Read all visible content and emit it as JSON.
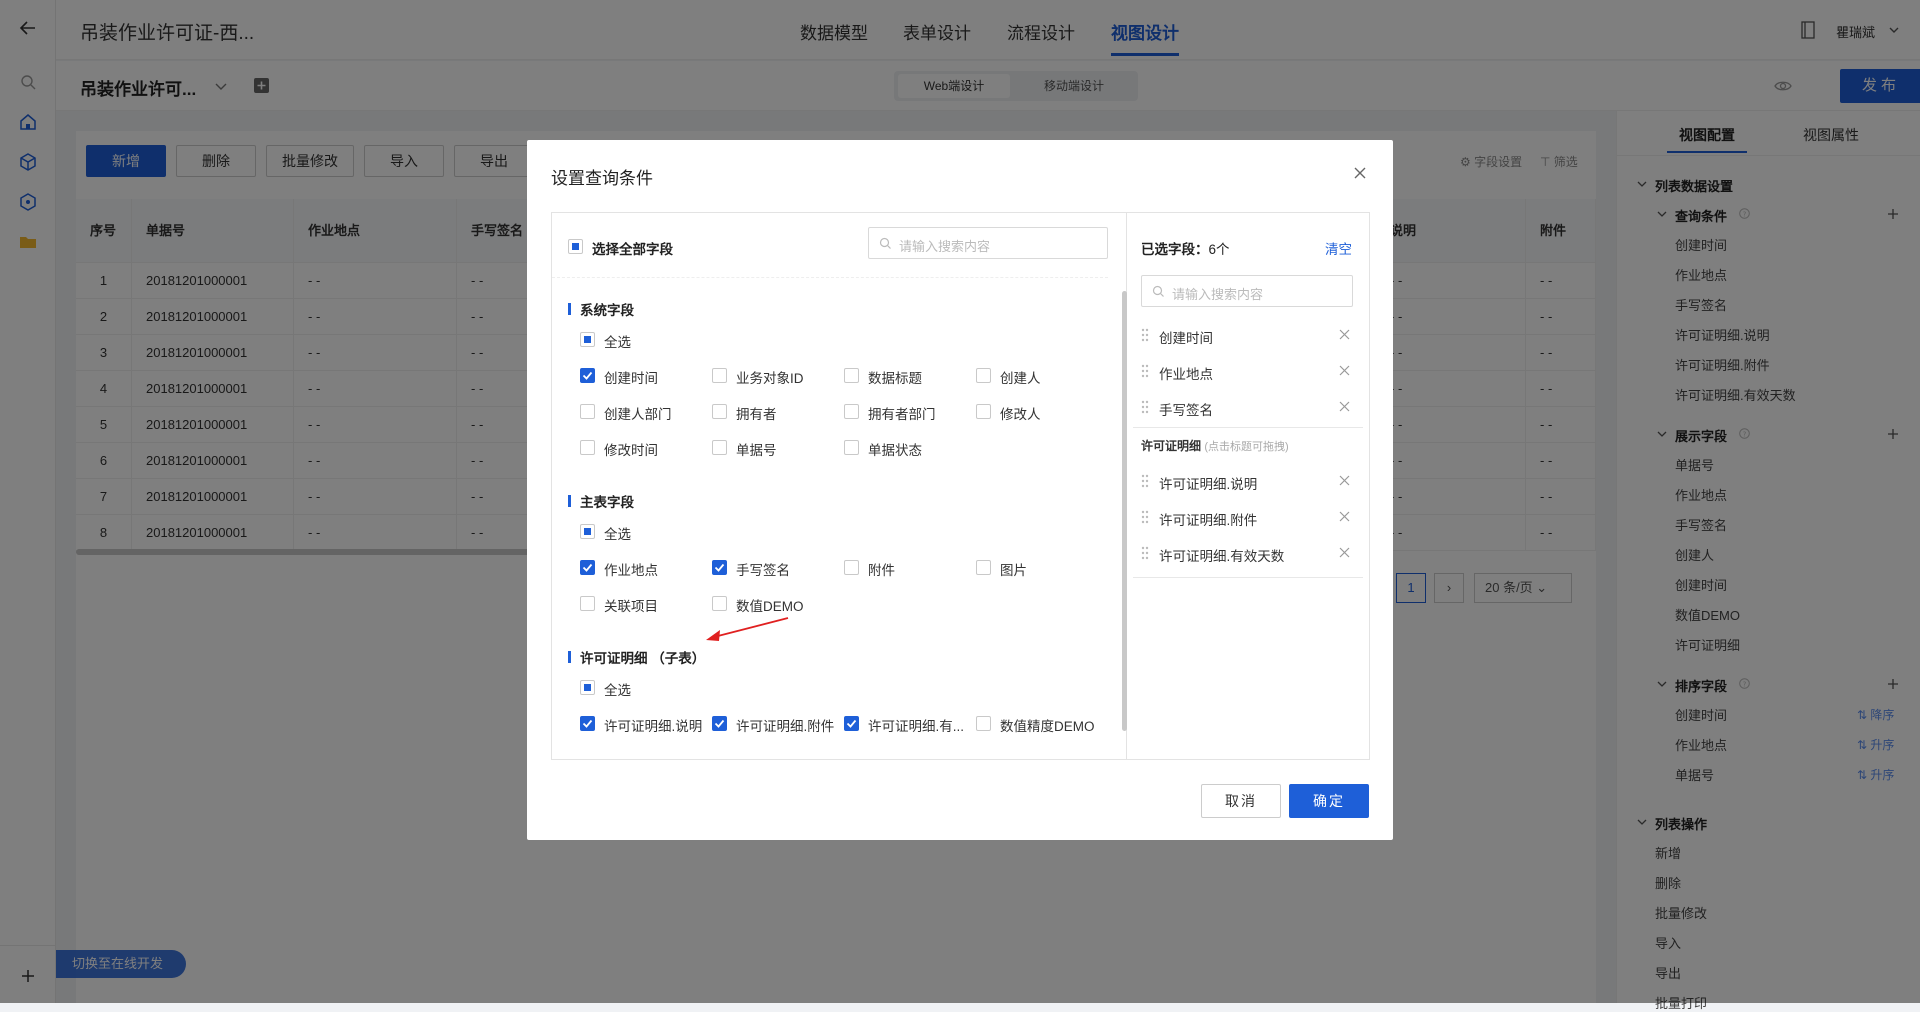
{
  "topbar": {
    "app_title": "吊装作业许可证-西...",
    "tabs": [
      "数据模型",
      "表单设计",
      "流程设计",
      "视图设计"
    ],
    "active_tab": "视图设计",
    "user_name": "瞿瑞斌"
  },
  "secbar": {
    "view_title": "吊装作业许可...",
    "seg_web": "Web端设计",
    "seg_mobile": "移动端设计",
    "publish": "发布"
  },
  "toolbar": {
    "buttons": [
      "新增",
      "删除",
      "批量修改",
      "导入",
      "导出"
    ],
    "field_settings": "字段设置",
    "filter": "筛选"
  },
  "table": {
    "headers": [
      "序号",
      "单据号",
      "作业地点",
      "手写签名",
      "说明",
      "附件"
    ],
    "rows": [
      {
        "no": "1",
        "doc": "20181201000001",
        "loc": "- -",
        "sign": "- -",
        "desc": "- -",
        "att": "- -"
      },
      {
        "no": "2",
        "doc": "20181201000001",
        "loc": "- -",
        "sign": "- -",
        "desc": "- -",
        "att": "- -"
      },
      {
        "no": "3",
        "doc": "20181201000001",
        "loc": "- -",
        "sign": "- -",
        "desc": "- -",
        "att": "- -"
      },
      {
        "no": "4",
        "doc": "20181201000001",
        "loc": "- -",
        "sign": "- -",
        "desc": "- -",
        "att": "- -"
      },
      {
        "no": "5",
        "doc": "20181201000001",
        "loc": "- -",
        "sign": "- -",
        "desc": "- -",
        "att": "- -"
      },
      {
        "no": "6",
        "doc": "20181201000001",
        "loc": "- -",
        "sign": "- -",
        "desc": "- -",
        "att": "- -"
      },
      {
        "no": "7",
        "doc": "20181201000001",
        "loc": "- -",
        "sign": "- -",
        "desc": "- -",
        "att": "- -"
      },
      {
        "no": "8",
        "doc": "20181201000001",
        "loc": "- -",
        "sign": "- -",
        "desc": "- -",
        "att": "- -"
      }
    ],
    "page_current": "1",
    "page_size": "20 条/页"
  },
  "switch_dev": "切换至在线开发",
  "rpanel": {
    "tabs": [
      "视图配置",
      "视图属性"
    ],
    "section_list": "列表数据设置",
    "query_title": "查询条件",
    "query_items": [
      "创建时间",
      "作业地点",
      "手写签名",
      "许可证明细.说明",
      "许可证明细.附件",
      "许可证明细.有效天数"
    ],
    "display_title": "展示字段",
    "display_items": [
      "单据号",
      "作业地点",
      "手写签名",
      "创建人",
      "创建时间",
      "数值DEMO",
      "许可证明细"
    ],
    "sort_title": "排序字段",
    "sort_items": [
      {
        "name": "创建时间",
        "order": "降序"
      },
      {
        "name": "作业地点",
        "order": "升序"
      },
      {
        "name": "单据号",
        "order": "升序"
      }
    ],
    "ops_title": "列表操作",
    "ops_items": [
      "新增",
      "删除",
      "批量修改",
      "导入",
      "导出",
      "批量打印"
    ]
  },
  "modal": {
    "title": "设置查询条件",
    "select_all_fields": "选择全部字段",
    "search_placeholder": "请输入搜索内容",
    "select_all": "全选",
    "groups": {
      "system": {
        "title": "系统字段",
        "fields": [
          {
            "label": "创建时间",
            "checked": true
          },
          {
            "label": "业务对象ID",
            "checked": false
          },
          {
            "label": "数据标题",
            "checked": false
          },
          {
            "label": "创建人",
            "checked": false
          },
          {
            "label": "创建人部门",
            "checked": false
          },
          {
            "label": "拥有者",
            "checked": false
          },
          {
            "label": "拥有者部门",
            "checked": false
          },
          {
            "label": "修改人",
            "checked": false
          },
          {
            "label": "修改时间",
            "checked": false
          },
          {
            "label": "单据号",
            "checked": false
          },
          {
            "label": "单据状态",
            "checked": false
          }
        ]
      },
      "main": {
        "title": "主表字段",
        "fields": [
          {
            "label": "作业地点",
            "checked": true
          },
          {
            "label": "手写签名",
            "checked": true
          },
          {
            "label": "附件",
            "checked": false
          },
          {
            "label": "图片",
            "checked": false
          },
          {
            "label": "关联项目",
            "checked": false
          },
          {
            "label": "数值DEMO",
            "checked": false
          }
        ]
      },
      "sub": {
        "title": "许可证明细 （子表）",
        "fields": [
          {
            "label": "许可证明细.说明",
            "checked": true
          },
          {
            "label": "许可证明细.附件",
            "checked": true
          },
          {
            "label": "许可证明细.有...",
            "checked": true
          },
          {
            "label": "数值精度DEMO",
            "checked": false
          }
        ]
      }
    },
    "selected_label": "已选字段：",
    "selected_count": "6个",
    "clear": "清空",
    "selected_main": [
      "创建时间",
      "作业地点",
      "手写签名"
    ],
    "sub_group_title": "许可证明细",
    "sub_group_hint": "(点击标题可拖拽)",
    "selected_sub": [
      "许可证明细.说明",
      "许可证明细.附件",
      "许可证明细.有效天数"
    ],
    "cancel": "取消",
    "confirm": "确定"
  },
  "colors": {
    "accent": "#1e5fd8",
    "arrow": "#e02020"
  }
}
